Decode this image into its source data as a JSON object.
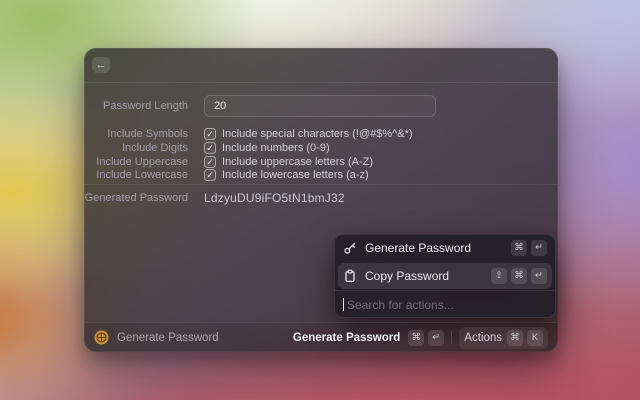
{
  "icons": {
    "back": "←",
    "check": "✓"
  },
  "colors": {
    "app_icon_amber": "#c9913d",
    "selection": "rgba(255,255,255,0.10)"
  },
  "form": {
    "rows": [
      {
        "label": "Password Length",
        "value": "20"
      },
      {
        "label": "Include Symbols",
        "checked": true,
        "text": "Include special characters (!@#$%^&*)"
      },
      {
        "label": "Include Digits",
        "checked": true,
        "text": "Include numbers (0-9)"
      },
      {
        "label": "Include Uppercase",
        "checked": true,
        "text": "Include uppercase letters (A-Z)"
      },
      {
        "label": "Include Lowercase",
        "checked": true,
        "text": "Include lowercase letters (a-z)"
      }
    ],
    "generated": {
      "label": "Generated Password",
      "value": "LdzyuDU9iFO5tN1bmJ32"
    }
  },
  "actions_popup": {
    "items": [
      {
        "icon": "key-icon",
        "label": "Generate Password",
        "keys": [
          "⌘",
          "↵"
        ],
        "selected": false
      },
      {
        "icon": "clipboard-icon",
        "label": "Copy Password",
        "keys": [
          "⇧",
          "⌘",
          "↵"
        ],
        "selected": true
      }
    ],
    "search_placeholder": "Search for actions..."
  },
  "statusbar": {
    "app_icon": "password-app-icon",
    "app_name": "Generate Password",
    "primary_action": {
      "label": "Generate Password",
      "keys": [
        "⌘",
        "↵"
      ]
    },
    "actions_button": {
      "label": "Actions",
      "keys": [
        "⌘",
        "K"
      ]
    }
  }
}
